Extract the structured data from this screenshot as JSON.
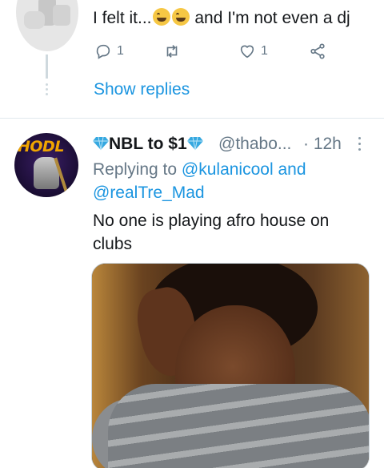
{
  "top_tweet": {
    "text_before": "I felt it...",
    "text_after": "and I'm not even a dj",
    "actions": {
      "reply_count": "1",
      "retweet_count": "",
      "like_count": "1"
    },
    "show_replies_label": "Show replies"
  },
  "tweet": {
    "avatar_text": "HODL",
    "display_name": "NBL to $1",
    "handle": "@thabo...",
    "time": "· 12h",
    "replying_prefix": "Replying to",
    "mention_1": "@kulanicool",
    "conjunction": "and",
    "mention_2": "@realTre_Mad",
    "text": "No one is playing afro house on clubs"
  },
  "colors": {
    "link": "#1b95e0",
    "secondary": "#657786",
    "primary_text": "#14171a",
    "divider": "#e1e8ed"
  },
  "icons": [
    "reply-icon",
    "retweet-icon",
    "like-icon",
    "share-icon",
    "more-icon",
    "diamond-icon"
  ]
}
